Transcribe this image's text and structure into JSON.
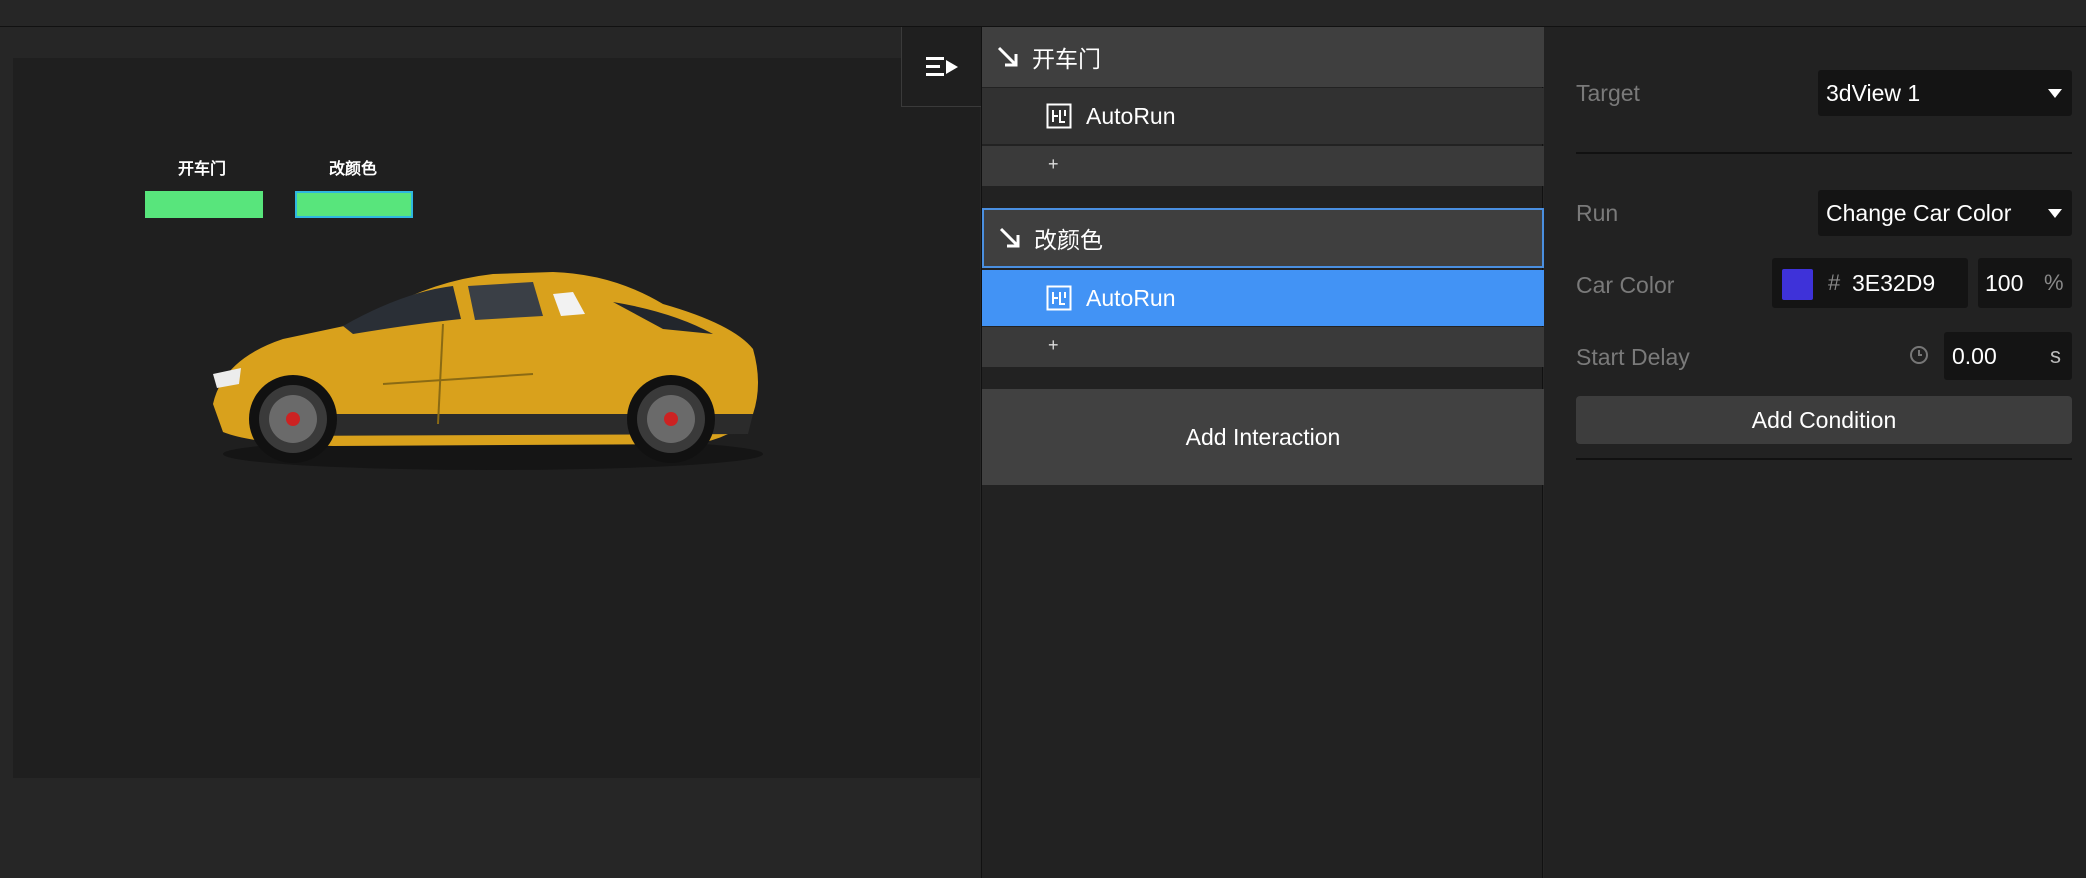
{
  "viewport": {
    "triggers": [
      {
        "label": "开车门",
        "color": "#58e57c"
      },
      {
        "label": "改颜色",
        "color": "#58e57c",
        "border": "#2fb7e0"
      }
    ],
    "car_color": "#d9a11c"
  },
  "interactions": {
    "groups": [
      {
        "title": "开车门",
        "action": "AutoRun",
        "add": "+"
      },
      {
        "title": "改颜色",
        "action": "AutoRun",
        "add": "+"
      }
    ],
    "add_interaction_label": "Add Interaction",
    "selection_color": "#4293f5"
  },
  "properties": {
    "target_label": "Target",
    "target_value": "3dView 1",
    "run_label": "Run",
    "run_value": "Change Car Color",
    "car_color_label": "Car Color",
    "car_color_hash": "#",
    "car_color_hex": "3E32D9",
    "car_color_swatch": "#3e32d9",
    "opacity_value": "100",
    "opacity_unit": "%",
    "start_delay_label": "Start Delay",
    "start_delay_value": "0.00",
    "start_delay_unit": "s",
    "add_condition_label": "Add Condition"
  }
}
